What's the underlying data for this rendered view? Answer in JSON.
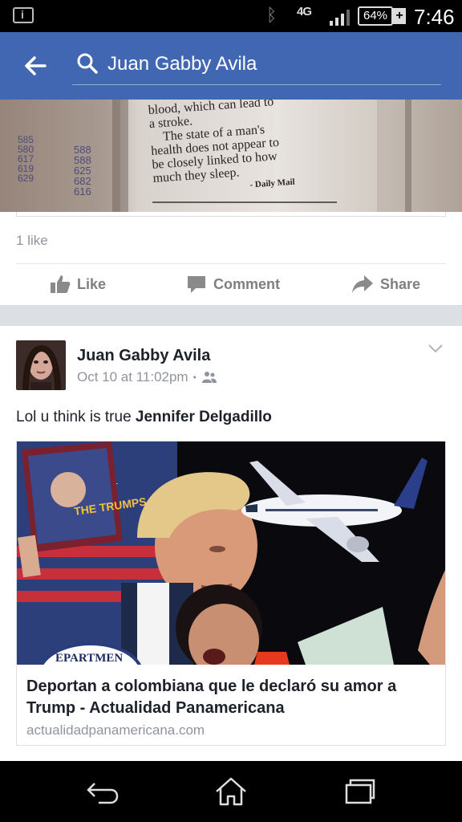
{
  "status_bar": {
    "network": "4G",
    "battery": "64%",
    "time": "7:46"
  },
  "header": {
    "search_query": "Juan Gabby Avila"
  },
  "post1": {
    "photo_text": [
      "blood, which can lead to",
      "a stroke.",
      "The state of a man's",
      "health does not appear to",
      "be closely linked to how",
      "much they sleep.",
      "- Daily Mail"
    ],
    "photo_numbers_left": [
      "585",
      "580",
      "617",
      "619",
      "629"
    ],
    "photo_numbers_right": [
      "588",
      "588",
      "625",
      "682",
      "616"
    ],
    "likes": "1 like",
    "actions": {
      "like": "Like",
      "comment": "Comment",
      "share": "Share"
    }
  },
  "post2": {
    "author": "Juan Gabby Avila",
    "timestamp": "Oct 10 at 11:02pm",
    "separator": "•",
    "text_prefix": "Lol u think is true ",
    "tagged_name": "Jennifer Delgadillo",
    "link": {
      "title": "Deportan a colombiana que le declaró su amor a Trump - Actualidad Panamericana",
      "domain": "actualidadpanamericana.com",
      "image_texts": {
        "seal": "EPARTMEN",
        "magazine": "THE TRUMPS"
      }
    }
  },
  "colors": {
    "facebook_blue": "#4267b2",
    "text_primary": "#1d2129",
    "text_secondary": "#90949c"
  }
}
